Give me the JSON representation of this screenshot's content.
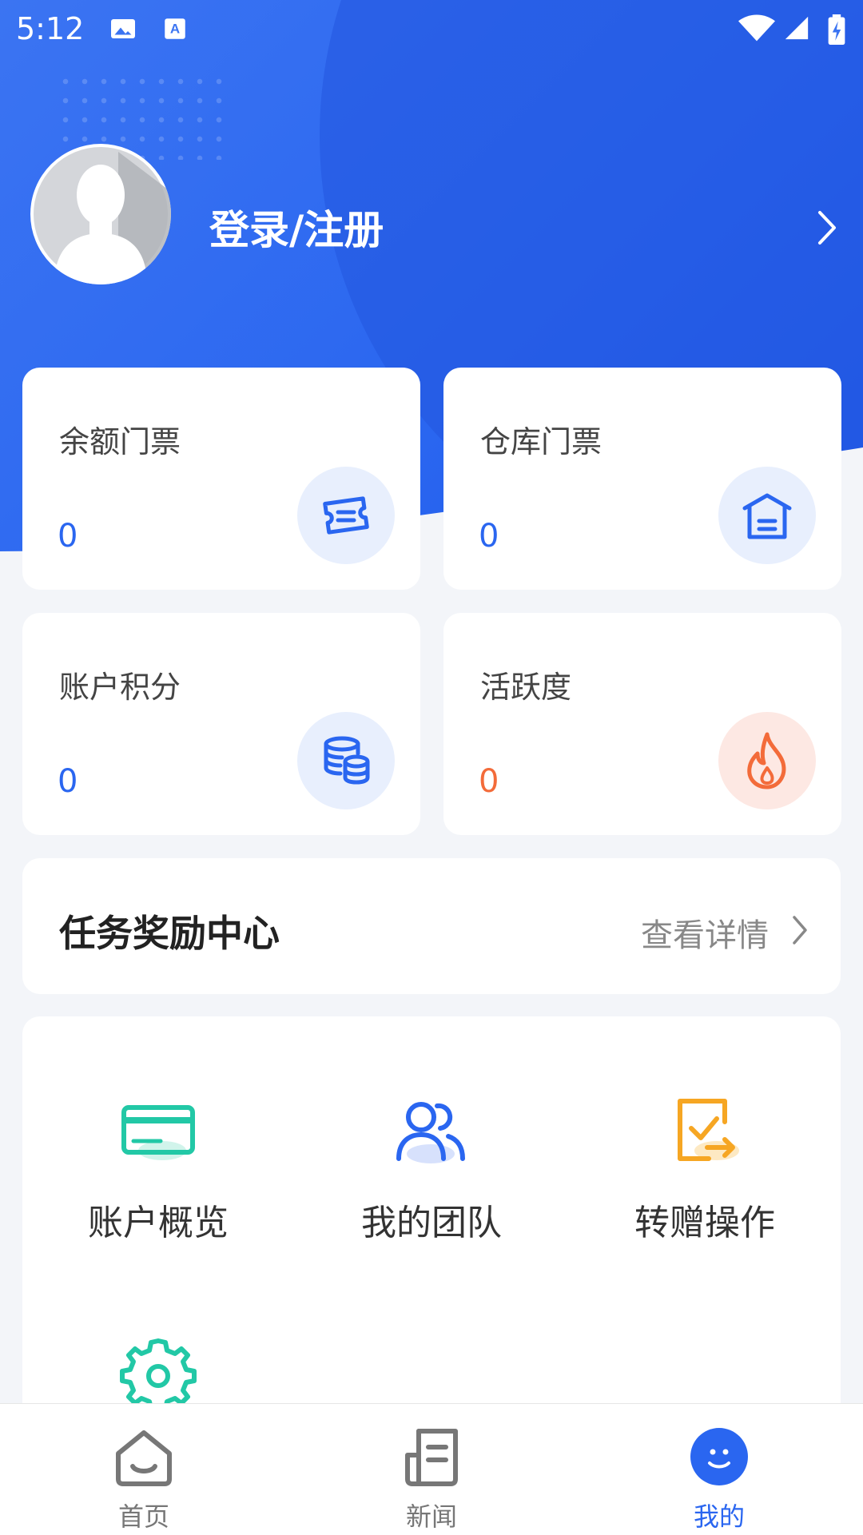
{
  "status_bar": {
    "time": "5:12"
  },
  "profile": {
    "login_label": "登录/注册"
  },
  "stats": [
    {
      "label": "余额门票",
      "value": "0",
      "icon": "ticket-icon"
    },
    {
      "label": "仓库门票",
      "value": "0",
      "icon": "warehouse-icon"
    },
    {
      "label": "账户积分",
      "value": "0",
      "icon": "coins-icon"
    },
    {
      "label": "活跃度",
      "value": "0",
      "icon": "fire-icon"
    }
  ],
  "task_center": {
    "title": "任务奖励中心",
    "more_label": "查看详情"
  },
  "features": [
    {
      "label": "账户概览",
      "icon": "card-icon"
    },
    {
      "label": "我的团队",
      "icon": "team-icon"
    },
    {
      "label": "转赠操作",
      "icon": "transfer-icon"
    },
    {
      "label": "",
      "icon": "settings-icon"
    }
  ],
  "tabbar": [
    {
      "label": "首页",
      "icon": "home-icon"
    },
    {
      "label": "新闻",
      "icon": "news-icon"
    },
    {
      "label": "我的",
      "icon": "smile-icon",
      "active": true
    }
  ],
  "colors": {
    "primary": "#2a66f0",
    "orange": "#f36b3a",
    "teal": "#22c8a6",
    "amber": "#f6a623"
  }
}
